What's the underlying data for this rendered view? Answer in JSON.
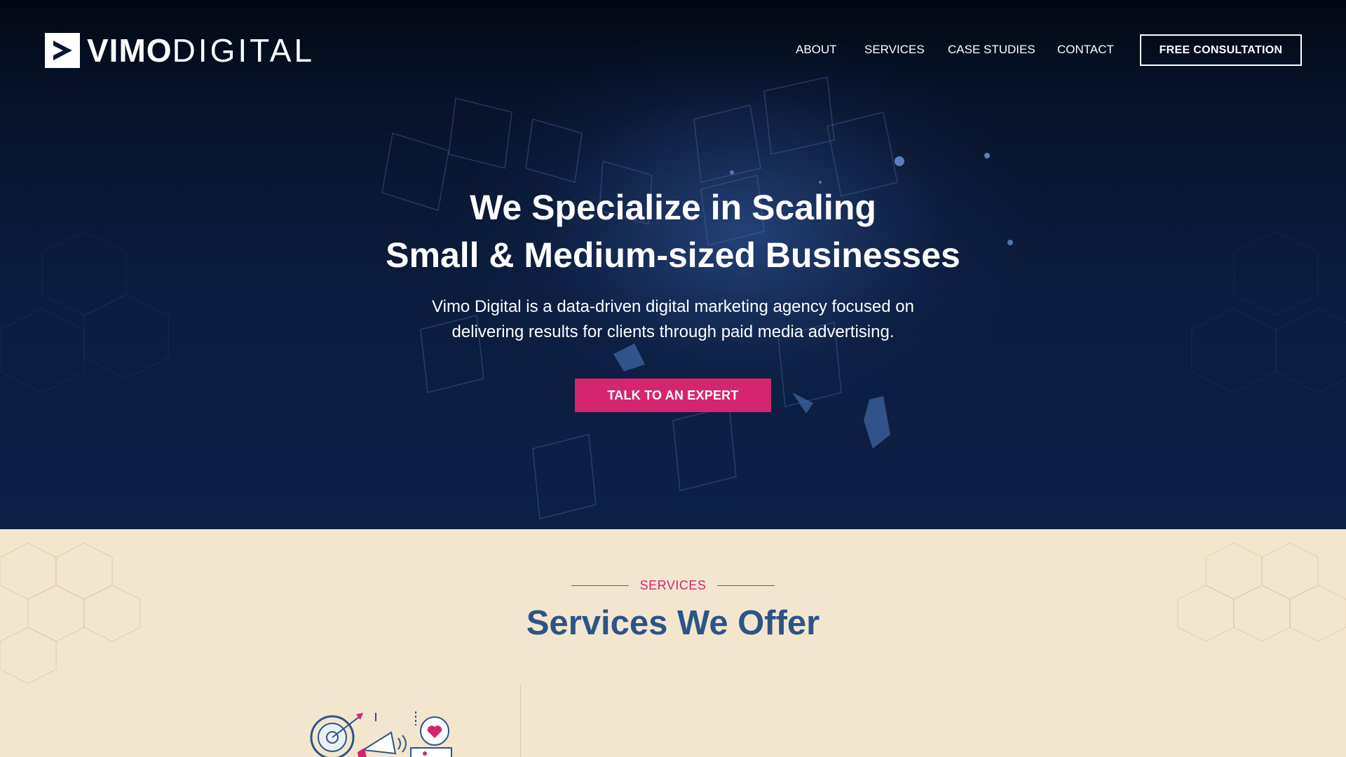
{
  "brand": {
    "name_bold": "VIMO",
    "name_light": "DIGITAL",
    "logo_icon": "play-arrow-icon"
  },
  "nav": {
    "items": [
      {
        "label": "ABOUT"
      },
      {
        "label": "SERVICES"
      },
      {
        "label": "CASE STUDIES"
      },
      {
        "label": "CONTACT"
      }
    ],
    "cta_label": "FREE CONSULTATION"
  },
  "hero": {
    "headline_line1": "We Specialize in Scaling",
    "headline_line2": "Small & Medium-sized Businesses",
    "subtext_line1": "Vimo Digital is a data-driven digital marketing agency focused on",
    "subtext_line2": "delivering results for clients through paid media advertising.",
    "cta_label": "TALK TO AN EXPERT"
  },
  "services": {
    "eyebrow": "SERVICES",
    "title": "Services We Offer",
    "illustration_icon": "marketing-megaphone-target-icon"
  },
  "colors": {
    "accent": "#d3266f",
    "hero_bg": "#0b1c3e",
    "services_bg": "#f3e6cf",
    "title_blue": "#2c5488"
  }
}
